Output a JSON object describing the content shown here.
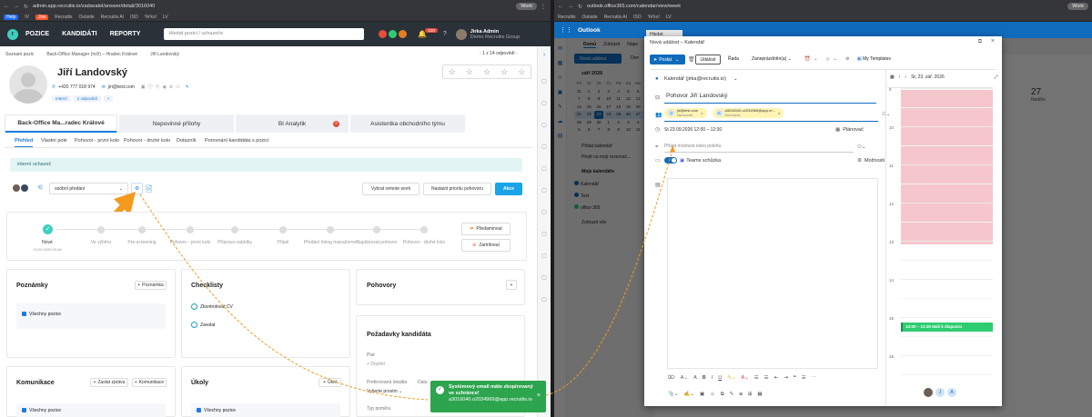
{
  "left_browser": {
    "url": "admin.app.recruitis.io/zadavatel/answer/detail/3016040",
    "profile": "Work",
    "bookmarks": [
      "Help",
      "IV",
      "Jira",
      "Recruitis",
      "Outside",
      "Recruitis AI",
      "ISO",
      "Ye'ko!",
      "LV"
    ]
  },
  "recruitis": {
    "nav": {
      "menu": [
        "POZICE",
        "KANDIDÁTI",
        "REPORTY"
      ],
      "search_placeholder": "Hledat pozici / uchazeče",
      "badge": "100",
      "user_name": "Jirka Admin",
      "user_company": "Demo Recruitis Group"
    },
    "breadcrumb": [
      "Seznam pozic",
      "Back-Office Manager (m/ž) – Hradec Králové",
      "Jiří Landovský"
    ],
    "pagination": "1 z 14 odpovědí",
    "candidate": {
      "name": "Jiří Landovský",
      "phone": "+420 777 018 974",
      "email": "jiri@test.com",
      "tags": [
        "Interní",
        "2 odpovědi"
      ]
    },
    "tabs": [
      "Back-Office Ma...radec Králové",
      "Nepovinné přílohy",
      "BI Analytik",
      "Asistentka obchodního týmu"
    ],
    "subtabs": [
      "Přehled",
      "Vlastní pole",
      "Pohovor - první kolo",
      "Pohovor - druhé kolo",
      "Dotazník",
      "Porovnání kandidáta s pozicí"
    ],
    "internal_label": "interní uchazeč",
    "assign_select": "osobní předání",
    "buttons": {
      "remote": "Vybrat remote work",
      "priority": "Nastavit prioritu pohovoru",
      "action": "Akce",
      "move": "Předaminout",
      "reject": "Zamítnout"
    },
    "steps": [
      "Nové",
      "Ve výběru",
      "Pre-screening",
      "Pohovor - první kolo",
      "Příprava nabídky",
      "Přijatí",
      "Předání hiring manažerovi",
      "Naplánovat pohovor",
      "Pohovor - druhé kolo"
    ],
    "step_date": "23.09.2026 09:46",
    "notes": {
      "title": "Poznámky",
      "add": "Poznámka",
      "item": "Všechny pozice"
    },
    "checklist": {
      "title": "Checklisty",
      "items": [
        "Zkontrolovat CV",
        "Zavolat"
      ]
    },
    "interviews": {
      "title": "Pohovory"
    },
    "requirements": {
      "title": "Požadavky kandidáta",
      "salary": "Plat",
      "add": "Doplnit",
      "location": "Preferovaná lokalita",
      "location_val": "Vyberte prosím",
      "date": "Datu",
      "type": "Typ poměru"
    },
    "communication": {
      "title": "Komunikace",
      "send": "Zaslat zprávu",
      "comm": "Komunikace",
      "item": "Všechny pozice"
    },
    "tasks": {
      "title": "Úkoly",
      "new": "Úkol",
      "item": "Všechny pozice"
    },
    "toast": {
      "line1": "Systémový email máte zkopírovaný ve schránce!",
      "line2": "a3016040.o2034969@app.recruitis.io"
    }
  },
  "right_browser": {
    "url": "outlook.office365.com/calendar/view/week",
    "profile": "Work",
    "bookmarks": [
      "Recruitis",
      "Outside",
      "Recruitis AI",
      "ISO",
      "Ye'ko!",
      "LV"
    ]
  },
  "outlook": {
    "app": "Outlook",
    "ribbon_tabs": [
      "Domů",
      "Zobrazit",
      "Nápo"
    ],
    "new_event": "Nová událost",
    "day": "Den",
    "month": "září 2026",
    "week_days": [
      "Po",
      "Út",
      "St",
      "Čt",
      "Pá",
      "So",
      "Ne"
    ],
    "calendar_rows": [
      [
        "31",
        "1",
        "2",
        "3",
        "4",
        "5",
        "6"
      ],
      [
        "7",
        "8",
        "9",
        "10",
        "11",
        "12",
        "13"
      ],
      [
        "14",
        "15",
        "16",
        "17",
        "18",
        "19",
        "20"
      ],
      [
        "21",
        "22",
        "23",
        "24",
        "25",
        "26",
        "27"
      ],
      [
        "28",
        "29",
        "30",
        "1",
        "2",
        "3",
        "4"
      ],
      [
        "5",
        "6",
        "7",
        "8",
        "9",
        "10",
        "11"
      ]
    ],
    "side_links": [
      "Přidat kalendář",
      "Přejít na mojí rezervač..."
    ],
    "my_calendars": "Moje kalendáře",
    "calendars": [
      "Kalendář",
      "Test",
      "office 365"
    ],
    "show_all": "Zobrazit vše",
    "bg_day_num": "27",
    "bg_day_name": "Neděle",
    "hidden_label": "Hledat"
  },
  "modal": {
    "title": "Nová událost – Kalendář",
    "send": "Poslat",
    "toolbar": [
      "Událost",
      "Řada",
      "Zaneprázdněn(a)",
      "My Templates"
    ],
    "calendar": "Kalendář (jirka@recruitis.io)",
    "subject": "Pohovor Jiří Landovský",
    "attendees": [
      {
        "initial": "J",
        "email": "jiri@test.com",
        "status": "Neznámé"
      },
      {
        "initial": "A",
        "email": "a3016040.o2034969@app.re...",
        "status": "Neznámé"
      }
    ],
    "datetime": "St 23.09.2026 12:00 – 12:30",
    "scheduler": "Plánovač",
    "location_placeholder": "Přidat místnost nebo polohu",
    "teams": "Teams schůzka",
    "options": "Možnosti",
    "day_header": "St, 23. zář. 2026",
    "hours": [
      "9",
      "10",
      "11",
      "12",
      "13",
      "14",
      "15",
      "16"
    ],
    "event_chip": "12:00 – 12:30 Máš k dispozici",
    "colors": {
      "brand": "#0f6cbd",
      "event": "#2ecc71",
      "busy": "#f5c6cb"
    }
  }
}
